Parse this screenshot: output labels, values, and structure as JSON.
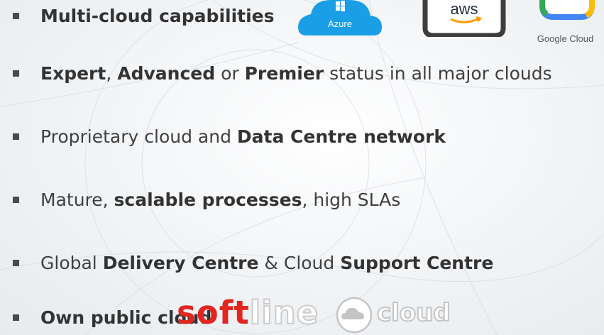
{
  "bullets": [
    {
      "segments": [
        {
          "text": "Multi-cloud capabilities",
          "bold": true
        }
      ]
    },
    {
      "segments": [
        {
          "text": "Expert",
          "bold": true
        },
        {
          "text": ", ",
          "bold": false
        },
        {
          "text": "Advanced",
          "bold": true
        },
        {
          "text": " or ",
          "bold": false
        },
        {
          "text": "Premier",
          "bold": true
        },
        {
          "text": " status in all major clouds",
          "bold": false
        }
      ]
    },
    {
      "segments": [
        {
          "text": "Proprietary cloud and ",
          "bold": false
        },
        {
          "text": "Data Centre network",
          "bold": true
        }
      ]
    },
    {
      "segments": [
        {
          "text": "Mature, ",
          "bold": false
        },
        {
          "text": "scalable processes",
          "bold": true
        },
        {
          "text": ", high SLAs",
          "bold": false
        }
      ]
    },
    {
      "segments": [
        {
          "text": "Global ",
          "bold": false
        },
        {
          "text": "Delivery Centre",
          "bold": true
        },
        {
          "text": " & Cloud ",
          "bold": false
        },
        {
          "text": "Support Centre",
          "bold": true
        }
      ]
    },
    {
      "segments": [
        {
          "text": "Own public cloud",
          "bold": true
        }
      ]
    }
  ],
  "logos": {
    "azure": {
      "label": "Azure",
      "icon": "windows-icon",
      "color": "#1a9fe6"
    },
    "aws": {
      "label": "aws",
      "color": "#ff9900"
    },
    "google_cloud": {
      "label": "Google Cloud",
      "colors": [
        "#4285f4",
        "#ea4335",
        "#fbbc05",
        "#34a853"
      ]
    },
    "softline": {
      "soft": "soft",
      "line": "line",
      "accent": "#e3251f"
    },
    "cloud": {
      "label": "cloud"
    }
  }
}
